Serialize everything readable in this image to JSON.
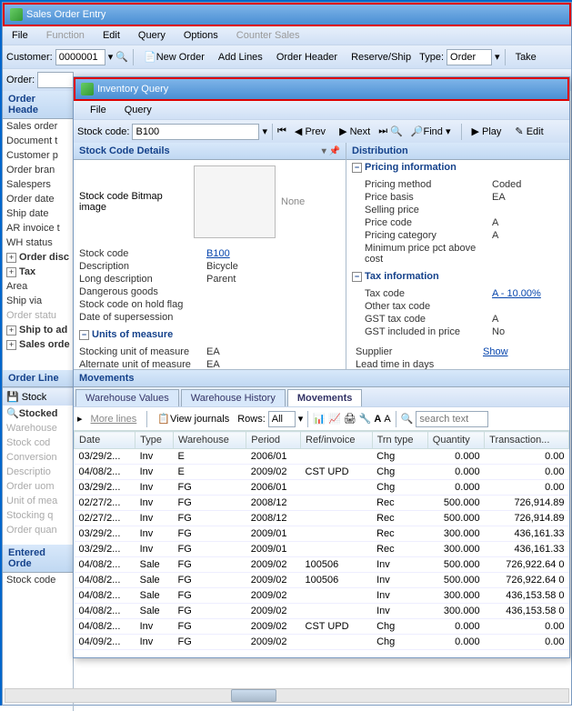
{
  "win1": {
    "title": "Sales Order Entry",
    "menu": [
      "File",
      "Function",
      "Edit",
      "Query",
      "Options",
      "Counter Sales"
    ],
    "menuDisabled": [
      1,
      5
    ],
    "customerLabel": "Customer:",
    "customerValue": "0000001",
    "buttons": [
      "New Order",
      "Add Lines",
      "Order Header",
      "Reserve/Ship"
    ],
    "typeLabel": "Type:",
    "typeValue": "Order",
    "takeLabel": "Take",
    "orderLabel": "Order:",
    "sidePanels": {
      "header": "Order Heade",
      "items1": [
        "Sales order",
        "Document t",
        "Customer p",
        "Order bran",
        "Salespers",
        "Order date",
        "Ship date",
        "AR invoice t",
        "WH status"
      ],
      "disc": "Order disc",
      "tax": "Tax",
      "items2": [
        "Area",
        "Ship via",
        "Order statu"
      ],
      "shipto": "Ship to ad",
      "salesord": "Sales orde",
      "orderline": "Order Line",
      "stockl": "Stock",
      "stocked": "Stocked",
      "items3": [
        "Warehouse",
        "Stock cod",
        "Conversion",
        "Descriptio",
        "Order uom",
        "Unit of mea",
        "Stocking q",
        "Order quan"
      ],
      "entered": "Entered Orde",
      "stockcode": "Stock code"
    }
  },
  "win2": {
    "title": "Inventory Query",
    "menu": [
      "File",
      "Query"
    ],
    "stockLabel": "Stock code:",
    "stockValue": "B100",
    "navPrev": "Prev",
    "navNext": "Next",
    "findLabel": "Find",
    "playLabel": "Play",
    "editLabel": "Edit",
    "leftPanel": {
      "title": "Stock Code Details",
      "bitmapLabel": "Stock code Bitmap image",
      "bitmapNone": "None",
      "rows": [
        {
          "l": "Stock code",
          "v": "B100",
          "link": true
        },
        {
          "l": "Description",
          "v": "Bicycle"
        },
        {
          "l": "Long description",
          "v": "Parent"
        },
        {
          "l": "Dangerous goods",
          "v": ""
        },
        {
          "l": "Stock code on hold flag",
          "v": ""
        },
        {
          "l": "Date of supersession",
          "v": ""
        }
      ],
      "uomHeader": "Units of measure",
      "uomRows": [
        {
          "l": "Stocking unit of measure",
          "v": "EA"
        },
        {
          "l": "Alternate unit of measure",
          "v": "EA"
        }
      ]
    },
    "rightPanel": {
      "title": "Distribution",
      "pricingHeader": "Pricing information",
      "pricingRows": [
        {
          "l": "Pricing method",
          "v": "Coded"
        },
        {
          "l": "Price basis",
          "v": "EA"
        },
        {
          "l": "Selling price",
          "v": ""
        },
        {
          "l": "Price code",
          "v": "A"
        },
        {
          "l": "Pricing category",
          "v": "A"
        },
        {
          "l": "Minimum price pct above cost",
          "v": ""
        }
      ],
      "taxHeader": "Tax information",
      "taxRows": [
        {
          "l": "Tax code",
          "v": "A - 10.00%",
          "link": true
        },
        {
          "l": "Other tax code",
          "v": ""
        },
        {
          "l": "GST tax code",
          "v": "A"
        },
        {
          "l": "GST included in price",
          "v": "No"
        }
      ],
      "misc": [
        {
          "l": "Supplier",
          "v": "Show",
          "link": true
        },
        {
          "l": "Lead time in days",
          "v": ""
        }
      ]
    },
    "movementsTitle": "Movements",
    "tabs": [
      "Warehouse Values",
      "Warehouse History",
      "Movements"
    ],
    "activeTab": 2,
    "gridToolbar": {
      "more": "More lines",
      "journals": "View journals",
      "rowsLabel": "Rows:",
      "rowsValue": "All",
      "searchPlaceholder": "search text"
    },
    "columns": [
      "Date",
      "Type",
      "Warehouse",
      "Period",
      "Ref/invoice",
      "Trn type",
      "Quantity",
      "Transaction..."
    ],
    "rows": [
      {
        "d": "03/29/2...",
        "t": "Inv",
        "w": "E",
        "p": "2006/01",
        "r": "",
        "tt": "Chg",
        "q": "0.000",
        "tr": "0.00"
      },
      {
        "d": "04/08/2...",
        "t": "Inv",
        "w": "E",
        "p": "2009/02",
        "r": "CST UPD",
        "tt": "Chg",
        "q": "0.000",
        "tr": "0.00"
      },
      {
        "d": "03/29/2...",
        "t": "Inv",
        "w": "FG",
        "p": "2006/01",
        "r": "",
        "tt": "Chg",
        "q": "0.000",
        "tr": "0.00"
      },
      {
        "d": "02/27/2...",
        "t": "Inv",
        "w": "FG",
        "p": "2008/12",
        "r": "",
        "tt": "Rec",
        "q": "500.000",
        "tr": "726,914.89"
      },
      {
        "d": "02/27/2...",
        "t": "Inv",
        "w": "FG",
        "p": "2008/12",
        "r": "",
        "tt": "Rec",
        "q": "500.000",
        "tr": "726,914.89"
      },
      {
        "d": "03/29/2...",
        "t": "Inv",
        "w": "FG",
        "p": "2009/01",
        "r": "",
        "tt": "Rec",
        "q": "300.000",
        "tr": "436,161.33"
      },
      {
        "d": "03/29/2...",
        "t": "Inv",
        "w": "FG",
        "p": "2009/01",
        "r": "",
        "tt": "Rec",
        "q": "300.000",
        "tr": "436,161.33"
      },
      {
        "d": "04/08/2...",
        "t": "Sale",
        "w": "FG",
        "p": "2009/02",
        "r": "100506",
        "tt": "Inv",
        "q": "500.000",
        "tr": "726,922.64 0"
      },
      {
        "d": "04/08/2...",
        "t": "Sale",
        "w": "FG",
        "p": "2009/02",
        "r": "100506",
        "tt": "Inv",
        "q": "500.000",
        "tr": "726,922.64 0"
      },
      {
        "d": "04/08/2...",
        "t": "Sale",
        "w": "FG",
        "p": "2009/02",
        "r": "",
        "tt": "Inv",
        "q": "300.000",
        "tr": "436,153.58 0"
      },
      {
        "d": "04/08/2...",
        "t": "Sale",
        "w": "FG",
        "p": "2009/02",
        "r": "",
        "tt": "Inv",
        "q": "300.000",
        "tr": "436,153.58 0"
      },
      {
        "d": "04/08/2...",
        "t": "Inv",
        "w": "FG",
        "p": "2009/02",
        "r": "CST UPD",
        "tt": "Chg",
        "q": "0.000",
        "tr": "0.00"
      },
      {
        "d": "04/09/2...",
        "t": "Inv",
        "w": "FG",
        "p": "2009/02",
        "r": "",
        "tt": "Chg",
        "q": "0.000",
        "tr": "0.00"
      }
    ]
  }
}
